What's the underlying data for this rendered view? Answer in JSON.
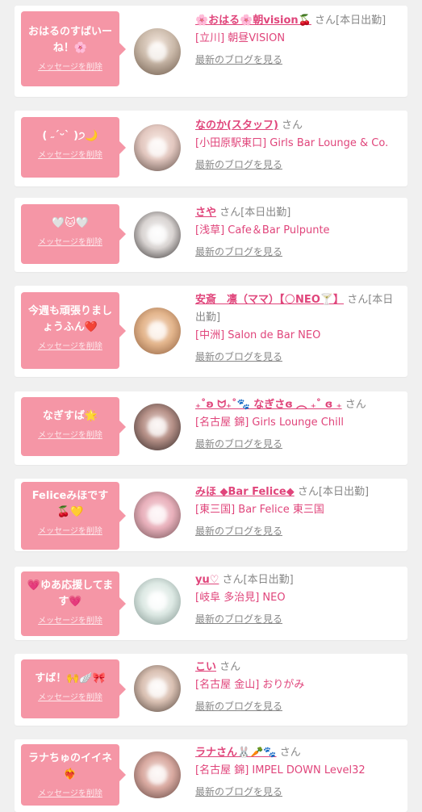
{
  "delete_label": "メッセージを削除",
  "blog_label": "最新のブログを見る",
  "colors": {
    "bubble": "#f596a6",
    "accent": "#e0457b"
  },
  "cards": [
    {
      "message": "おはるのすばいーね！🌸",
      "name": "🌸おはる🌸朝vision🍒",
      "suffix": "さん[本日出勤]",
      "shop": "[立川] 朝昼VISION"
    },
    {
      "message": "( ˶ˊᵕˋ )੭🌙",
      "name": "なのか(スタッフ)",
      "suffix": "さん",
      "shop": "[小田原駅東口] Girls Bar Lounge & Co."
    },
    {
      "message": "🤍🐱🤍",
      "name": "さや",
      "suffix": "さん[本日出勤]",
      "shop": "[浅草] Cafe＆Bar Pulpunte"
    },
    {
      "message": "今週も頑張りましょうふん❤️",
      "name": "安斎　凛（ママ）【🌕NEO🍸】",
      "suffix": "さん[本日出勤]",
      "shop": "[中洲] Salon de Bar NEO"
    },
    {
      "message": "なぎすば🌟",
      "name": "₊˚ʚ ᗢ₊˚🐾 なぎさɞ ︵ ₊˚ ɞ ₊",
      "suffix": "さん",
      "shop": "[名古屋 錦] Girls Lounge Chill"
    },
    {
      "message": "Feliceみほです🍒💛",
      "name": "みほ ◆Bar Felice◆",
      "suffix": "さん[本日出勤]",
      "shop": "[東三国] Bar Felice 東三国"
    },
    {
      "message": "💗ゆあ応援してます💗",
      "name": "yu♡",
      "suffix": "さん[本日出勤]",
      "shop": "[岐阜 多治見] NEO"
    },
    {
      "message": "すば！🙌🪽🎀",
      "name": "こい",
      "suffix": "さん",
      "shop": "[名古屋 金山] おりがみ"
    },
    {
      "message": "ラナちゅのイイネ❤️‍🔥",
      "name": "ラナさん🐰🥕🐾",
      "suffix": "さん",
      "shop": "[名古屋 錦] IMPEL DOWN Level32"
    }
  ]
}
